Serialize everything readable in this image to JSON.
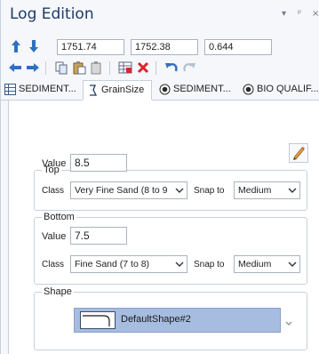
{
  "window": {
    "title": "Log Edition",
    "controls": {
      "menu": "▾",
      "pin": "ᵖ",
      "close": "×"
    }
  },
  "toolbar": {
    "depth_top": "1751.74",
    "depth_bottom": "1752.38",
    "thickness": "0.644",
    "icons": [
      "arrow-up-icon",
      "arrow-down-icon",
      "arrow-left-icon",
      "arrow-right-icon",
      "copy-icon",
      "paste-icon",
      "paste-special-icon",
      "grid-icon",
      "delete-icon",
      "undo-icon",
      "redo-icon"
    ]
  },
  "tabs": [
    {
      "label": "SEDIMENT...",
      "icon": "table-icon",
      "active": false
    },
    {
      "label": "GrainSize",
      "icon": "grainsize-icon",
      "active": true
    },
    {
      "label": "SEDIMENT...",
      "icon": "target-icon",
      "active": false
    },
    {
      "label": "BIO QUALIF...",
      "icon": "target-icon",
      "active": false
    }
  ],
  "top": {
    "legend": "Top",
    "value_label": "Value",
    "value": "8.5",
    "class_label": "Class",
    "class_value": "Very Fine Sand (8 to 9",
    "snap_label": "Snap to",
    "snap_value": "Medium"
  },
  "bottom": {
    "legend": "Bottom",
    "value_label": "Value",
    "value": "7.5",
    "class_label": "Class",
    "class_value": "Fine Sand (7 to 8)",
    "snap_label": "Snap to",
    "snap_value": "Medium"
  },
  "shape": {
    "legend": "Shape",
    "value": "DefaultShape#2"
  },
  "colors": {
    "title": "#1e3a66",
    "accent_blue": "#2f6fc0",
    "shape_fill": "#a6bce0",
    "delete_red": "#d6262b"
  }
}
